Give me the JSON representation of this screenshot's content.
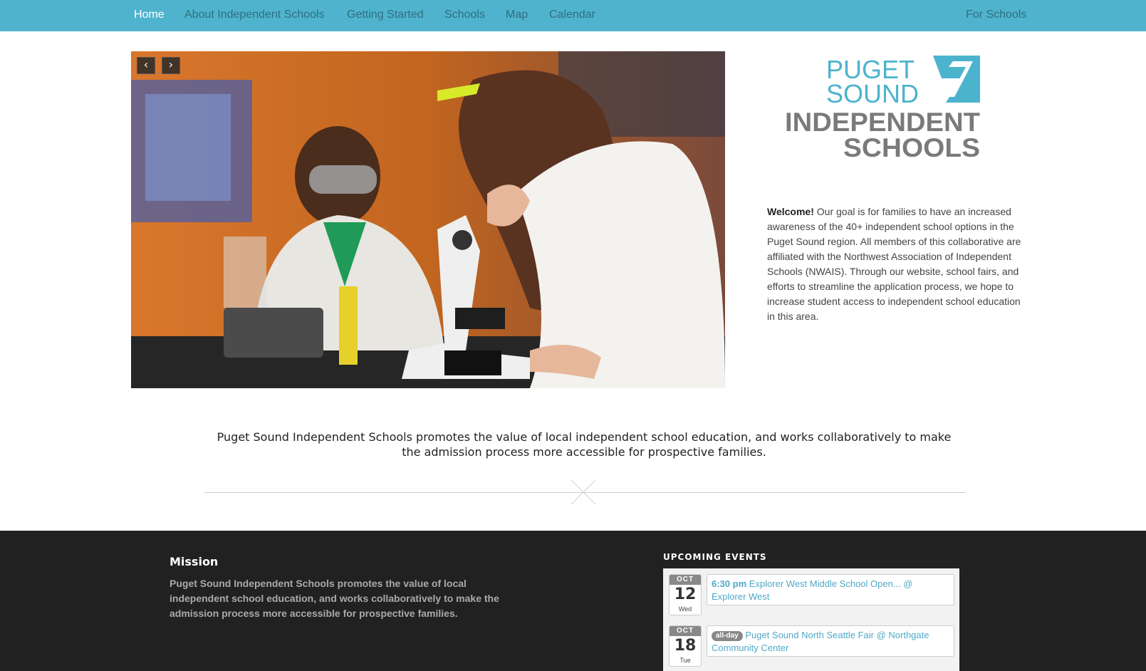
{
  "nav": {
    "items": [
      {
        "label": "Home"
      },
      {
        "label": "About Independent Schools"
      },
      {
        "label": "Getting Started"
      },
      {
        "label": "Schools"
      },
      {
        "label": "Map"
      },
      {
        "label": "Calendar"
      }
    ],
    "right": "For Schools"
  },
  "hero": {
    "prev_icon": "chevron-left-icon",
    "next_icon": "chevron-right-icon",
    "prev_label": "‹",
    "next_label": "›"
  },
  "logo": {
    "line1": "PUGET",
    "line2": "SOUND",
    "line3": "INDEPENDENT",
    "line4": "SCHOOLS",
    "color_teal": "#4cb3cd",
    "color_gray": "#7a7a7a"
  },
  "welcome": {
    "lead": "Welcome!",
    "text": " Our goal is for families to have an increased awareness of the 40+ independent school options in the Puget Sound region. All members of this collaborative are affiliated with the Northwest Association of Independent Schools (NWAIS). Through our website, school fairs, and efforts to streamline the application process, we hope to increase student access to independent school education in this area."
  },
  "tagline": "Puget Sound Independent Schools promotes the value of local independent school education, and works collaboratively to make the admission process more accessible for prospective families.",
  "footer": {
    "mission_title": "Mission",
    "mission_text": "Puget Sound Independent Schools promotes the value of local independent school education, and works collaboratively to make the admission process more accessible for prospective families.",
    "events_title": "UPCOMING EVENTS",
    "events": [
      {
        "month": "OCT",
        "day": "12",
        "dow": "Wed",
        "time": "6:30 pm",
        "title": "Explorer West Middle School Open... @ Explorer West"
      },
      {
        "month": "OCT",
        "day": "18",
        "dow": "Tue",
        "badge": "all-day",
        "title": "Puget Sound North Seattle Fair @ Northgate Community Center"
      }
    ]
  },
  "colors": {
    "nav_bg": "#4fb3cd",
    "footer_bg": "#212121",
    "link": "#4fa9c8"
  }
}
